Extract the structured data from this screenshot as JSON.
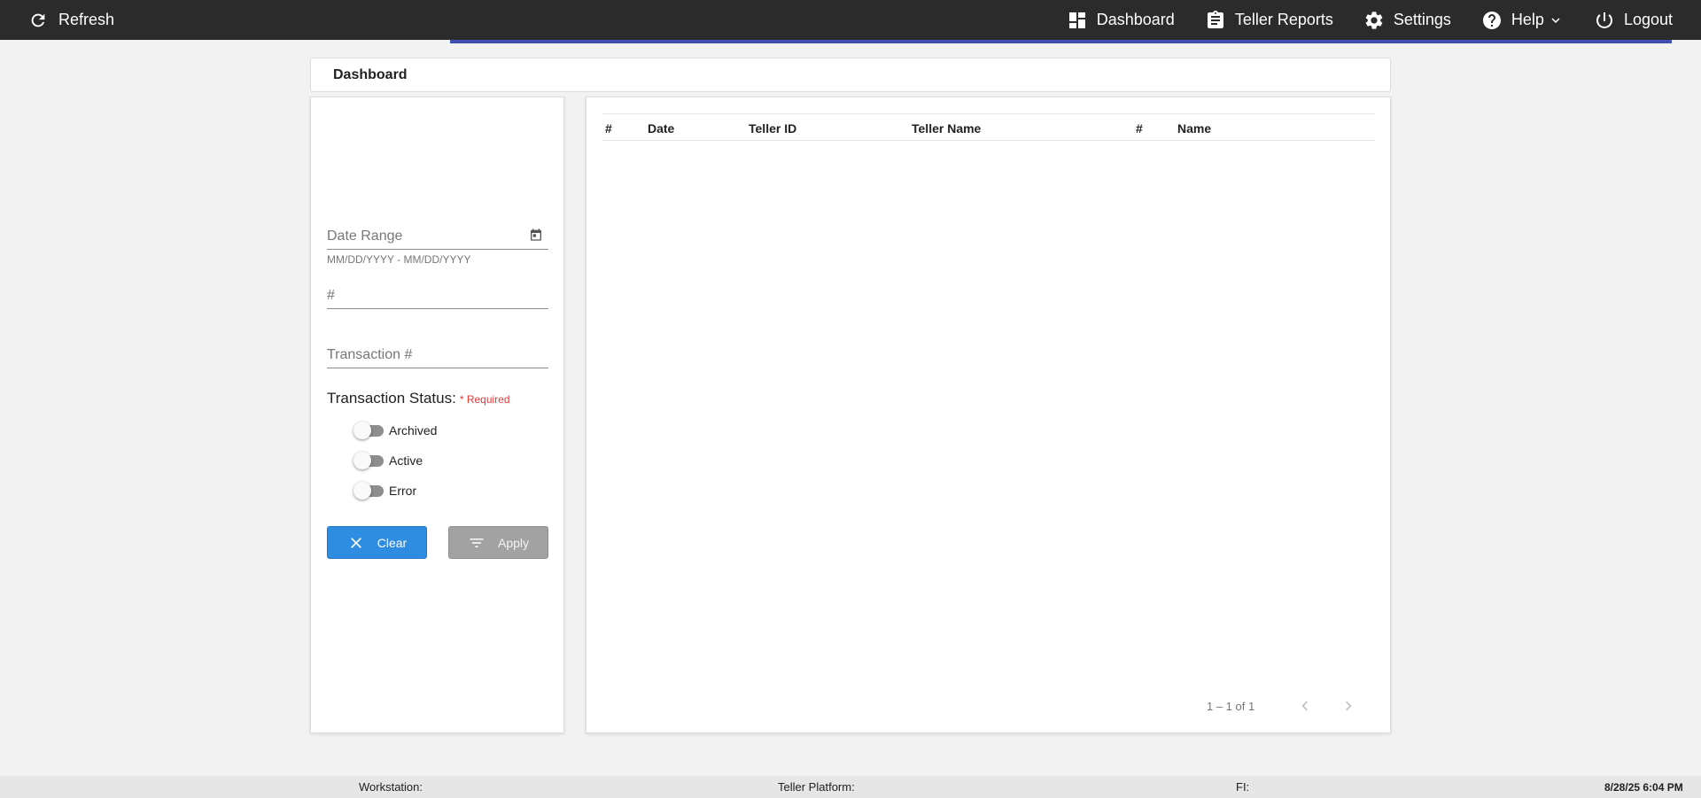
{
  "topbar": {
    "refresh_label": "Refresh",
    "nav": {
      "dashboard": "Dashboard",
      "teller_reports": "Teller Reports",
      "settings": "Settings",
      "help": "Help",
      "logout": "Logout"
    },
    "accent_color": "#3f51b5",
    "bg_color": "#2b2b2b"
  },
  "breadcrumb": {
    "title": "Dashboard"
  },
  "filters": {
    "date_range": {
      "placeholder": "Date Range",
      "hint": "MM/DD/YYYY - MM/DD/YYYY",
      "value": ""
    },
    "number": {
      "placeholder": "#",
      "value": ""
    },
    "transaction_number": {
      "placeholder": "Transaction #",
      "value": ""
    },
    "transaction_status": {
      "label": "Transaction Status:",
      "required_text": "* Required",
      "options": [
        {
          "label": "Archived",
          "checked": false
        },
        {
          "label": "Active",
          "checked": false
        },
        {
          "label": "Error",
          "checked": false
        }
      ]
    },
    "clear_label": "Clear",
    "apply_label": "Apply",
    "clear_color": "#2e8de0",
    "apply_color": "#a2a2a2"
  },
  "table": {
    "columns": [
      "#",
      "Date",
      "Teller ID",
      "Teller Name",
      "#",
      "Name"
    ],
    "rows": [],
    "pagination": {
      "range_label": "1 – 1 of 1"
    }
  },
  "footer": {
    "workstation_label": "Workstation:",
    "platform_label": "Teller Platform:",
    "fi_label": "FI:",
    "datetime": "8/28/25 6:04 PM"
  }
}
